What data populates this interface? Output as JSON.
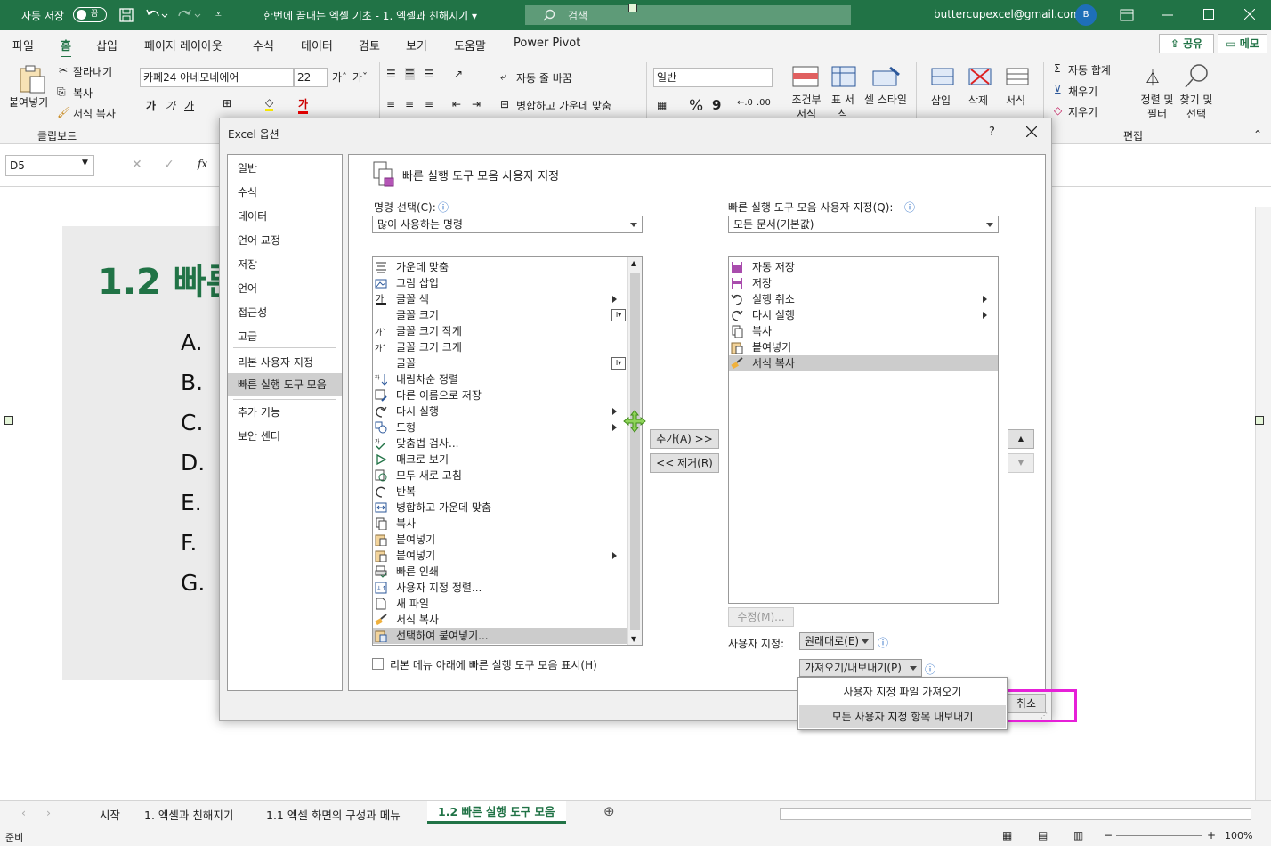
{
  "titlebar": {
    "autosave_label": "자동 저장",
    "autosave_state": "끔",
    "doc_title": "한번에 끝내는 엑셀 기초 - 1. 엑셀과 친해지기 ▾",
    "search_placeholder": "검색",
    "account_email": "buttercupexcel@gmail.com",
    "avatar_initial": "B"
  },
  "menu": {
    "tabs": [
      "파일",
      "홈",
      "삽입",
      "페이지 레이아웃",
      "수식",
      "데이터",
      "검토",
      "보기",
      "도움말",
      "Power Pivot"
    ],
    "active_tab": "홈",
    "share_label": "공유",
    "memo_label": "메모"
  },
  "ribbon": {
    "paste_label": "붙여넣기",
    "cut_label": "잘라내기",
    "copy_label": "복사",
    "format_painter_label": "서식 복사",
    "clipboard_group": "클립보드",
    "font_name": "카페24 아네모네에어",
    "font_size": "22",
    "bold_label": "가",
    "italic_label": "가",
    "underline_label": "가",
    "font_color_label": "가",
    "wrap_text_label": "자동 줄 바꿈",
    "merge_center_label": "병합하고 가운데 맞춤",
    "number_format": "일반",
    "percent_label": "%",
    "comma_label": "9",
    "cond_format_label": "조건부 서식",
    "table_format_label": "표 서식",
    "cell_style_label": "셀 스타일",
    "insert_label": "삽입",
    "delete_label": "삭제",
    "format_label": "서식",
    "autosum_label": "자동 합계",
    "fill_label": "채우기",
    "clear_label": "지우기",
    "sort_filter_label": "정렬 및 필터",
    "find_select_label": "찾기 및 선택",
    "edit_group": "편집"
  },
  "formula_bar": {
    "name_box": "D5",
    "fx_label": "fx"
  },
  "sheet": {
    "slide_title": "1.2 빠른",
    "letters": [
      "A.",
      "B.",
      "C.",
      "D.",
      "E.",
      "F.",
      "G."
    ]
  },
  "dialog": {
    "title": "Excel 옵션",
    "help_label": "?",
    "nav_items": [
      "일반",
      "수식",
      "데이터",
      "언어 교정",
      "저장",
      "언어",
      "접근성",
      "고급",
      "리본 사용자 지정",
      "빠른 실행 도구 모음",
      "추가 기능",
      "보안 센터"
    ],
    "selected_nav": "빠른 실행 도구 모음",
    "section_title": "빠른 실행 도구 모음 사용자 지정",
    "choose_commands_label": "명령 선택(C):",
    "choose_commands_value": "많이 사용하는 명령",
    "customize_qat_label": "빠른 실행 도구 모음 사용자 지정(Q):",
    "customize_qat_value": "모든 문서(기본값)",
    "commands": [
      {
        "label": "가운데 맞춤",
        "icon": "align-center-icon",
        "sub": ""
      },
      {
        "label": "그림 삽입",
        "icon": "picture-icon",
        "sub": ""
      },
      {
        "label": "글꼴 색",
        "icon": "font-color-icon",
        "sub": "arrow"
      },
      {
        "label": "글꼴 크기",
        "icon": "none",
        "sub": "box"
      },
      {
        "label": "글꼴 크기 작게",
        "icon": "font-smaller-icon",
        "sub": ""
      },
      {
        "label": "글꼴 크기 크게",
        "icon": "font-larger-icon",
        "sub": ""
      },
      {
        "label": "글꼴",
        "icon": "none",
        "sub": "box"
      },
      {
        "label": "내림차순 정렬",
        "icon": "sort-desc-icon",
        "sub": ""
      },
      {
        "label": "다른 이름으로 저장",
        "icon": "save-as-icon",
        "sub": ""
      },
      {
        "label": "다시 실행",
        "icon": "redo-icon",
        "sub": "arrow"
      },
      {
        "label": "도형",
        "icon": "shapes-icon",
        "sub": "arrow"
      },
      {
        "label": "맞춤법 검사...",
        "icon": "spelling-icon",
        "sub": ""
      },
      {
        "label": "매크로 보기",
        "icon": "macro-icon",
        "sub": ""
      },
      {
        "label": "모두 새로 고침",
        "icon": "refresh-icon",
        "sub": ""
      },
      {
        "label": "반복",
        "icon": "repeat-icon",
        "sub": ""
      },
      {
        "label": "병합하고 가운데 맞춤",
        "icon": "merge-icon",
        "sub": ""
      },
      {
        "label": "복사",
        "icon": "copy-icon",
        "sub": ""
      },
      {
        "label": "붙여넣기",
        "icon": "paste-icon",
        "sub": ""
      },
      {
        "label": "붙여넣기",
        "icon": "paste-icon",
        "sub": "arrow"
      },
      {
        "label": "빠른 인쇄",
        "icon": "print-icon",
        "sub": ""
      },
      {
        "label": "사용자 지정 정렬...",
        "icon": "custom-sort-icon",
        "sub": ""
      },
      {
        "label": "새 파일",
        "icon": "new-file-icon",
        "sub": ""
      },
      {
        "label": "서식 복사",
        "icon": "format-painter-icon",
        "sub": ""
      },
      {
        "label": "선택하여 붙여넣기...",
        "icon": "paste-special-icon",
        "sub": ""
      }
    ],
    "selected_command": 23,
    "qat_items": [
      {
        "label": "자동 저장",
        "icon": "autosave-icon",
        "sub": ""
      },
      {
        "label": "저장",
        "icon": "save-icon",
        "sub": ""
      },
      {
        "label": "실행 취소",
        "icon": "undo-icon",
        "sub": "arrow"
      },
      {
        "label": "다시 실행",
        "icon": "redo-icon",
        "sub": "arrow"
      },
      {
        "label": "복사",
        "icon": "copy-icon",
        "sub": ""
      },
      {
        "label": "붙여넣기",
        "icon": "paste-icon",
        "sub": ""
      },
      {
        "label": "서식 복사",
        "icon": "format-painter-icon",
        "sub": ""
      }
    ],
    "selected_qat": 6,
    "add_button": "추가(A) >>",
    "remove_button": "<< 제거(R)",
    "modify_button": "수정(M)...",
    "customizations_label": "사용자 지정:",
    "reset_button": "원래대로(E)",
    "import_export_button": "가져오기/내보내기(P)",
    "show_below_ribbon_label": "리본 메뉴 아래에 빠른 실행 도구 모음 표시(H)",
    "cancel_button": "취소",
    "popup_items": [
      "사용자 지정 파일 가져오기",
      "모든 사용자 지정 항목 내보내기"
    ],
    "popup_selected": 1
  },
  "sheet_tabs": {
    "tabs": [
      "시작",
      "1. 엑셀과 친해지기",
      "1.1 엑셀 화면의 구성과 메뉴",
      "1.2 빠른 실행 도구 모음"
    ],
    "active": "1.2 빠른 실행 도구 모음"
  },
  "status": {
    "ready": "준비",
    "zoom": "100%"
  },
  "colors": {
    "brand_green": "#217346",
    "highlight_magenta": "#e620d8",
    "selection_gray": "#cccccc"
  }
}
